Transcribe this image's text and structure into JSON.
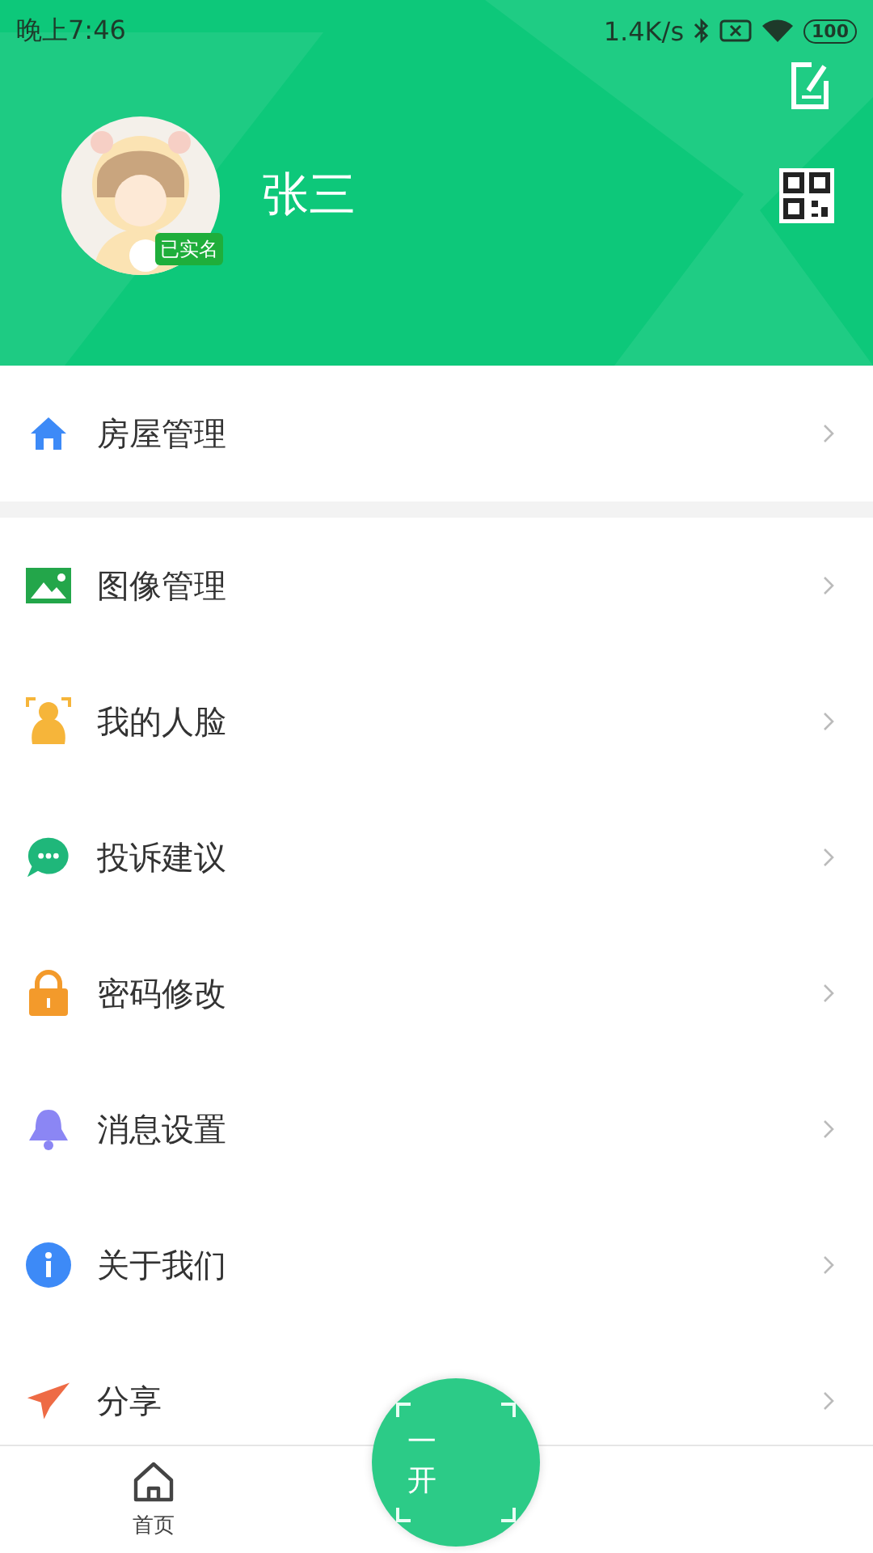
{
  "status_bar": {
    "time": "晚上7:46",
    "speed": "1.4K/s",
    "battery": "100"
  },
  "profile": {
    "name": "张三",
    "badge": "已实名"
  },
  "menu_groups": [
    [
      {
        "label": "房屋管理"
      }
    ],
    [
      {
        "label": "图像管理"
      },
      {
        "label": "我的人脸"
      },
      {
        "label": "投诉建议"
      },
      {
        "label": "密码修改"
      },
      {
        "label": "消息设置"
      },
      {
        "label": "关于我们"
      },
      {
        "label": "分享"
      }
    ]
  ],
  "bottom_nav": {
    "tabs": [
      {
        "label": "首页",
        "selected": false
      }
    ],
    "center_button": {
      "lines": [
        "一",
        "开"
      ]
    }
  }
}
